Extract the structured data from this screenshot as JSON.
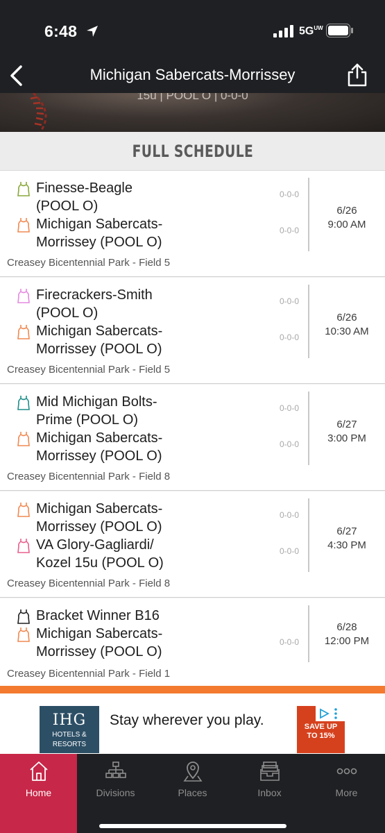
{
  "status_bar": {
    "time": "6:48",
    "network": "5G",
    "network_sup": "UW"
  },
  "nav": {
    "title": "Michigan Sabercats-Morrissey"
  },
  "banner": {
    "text": "15u | POOL O | 0-0-0"
  },
  "section": {
    "title": "FULL SCHEDULE"
  },
  "games": [
    {
      "team1": {
        "name_line1": "Finesse-Beagle",
        "name_line2": "(POOL O)",
        "score": "0-0-0",
        "color": "#8aa83c"
      },
      "team2": {
        "name_line1": "Michigan Sabercats-",
        "name_line2": "Morrissey (POOL O)",
        "score": "0-0-0",
        "color": "#f08a52"
      },
      "date": "6/26",
      "time": "9:00 AM",
      "venue": "Creasey Bicentennial Park - Field 5"
    },
    {
      "team1": {
        "name_line1": "Firecrackers-Smith",
        "name_line2": "(POOL O)",
        "score": "0-0-0",
        "color": "#e48ae0"
      },
      "team2": {
        "name_line1": "Michigan Sabercats-",
        "name_line2": "Morrissey (POOL O)",
        "score": "0-0-0",
        "color": "#f08a52"
      },
      "date": "6/26",
      "time": "10:30 AM",
      "venue": "Creasey Bicentennial Park - Field 5"
    },
    {
      "team1": {
        "name_line1": "Mid Michigan Bolts-",
        "name_line2": "Prime (POOL O)",
        "score": "0-0-0",
        "color": "#1f8f8a"
      },
      "team2": {
        "name_line1": "Michigan Sabercats-",
        "name_line2": "Morrissey (POOL O)",
        "score": "0-0-0",
        "color": "#f08a52"
      },
      "date": "6/27",
      "time": "3:00 PM",
      "venue": "Creasey Bicentennial Park - Field 8"
    },
    {
      "team1": {
        "name_line1": "Michigan Sabercats-",
        "name_line2": "Morrissey (POOL O)",
        "score": "0-0-0",
        "color": "#f08a52"
      },
      "team2": {
        "name_line1": "VA Glory-Gagliardi/",
        "name_line2": "Kozel 15u (POOL O)",
        "score": "0-0-0",
        "color": "#e8608e"
      },
      "date": "6/27",
      "time": "4:30 PM",
      "venue": "Creasey Bicentennial Park - Field 8"
    },
    {
      "team1": {
        "name_line1": "Bracket Winner B16",
        "name_line2": "",
        "score": "",
        "color": "#222222"
      },
      "team2": {
        "name_line1": "Michigan Sabercats-",
        "name_line2": "Morrissey (POOL O)",
        "score": "0-0-0",
        "color": "#f08a52"
      },
      "date": "6/28",
      "time": "12:00 PM",
      "venue": "Creasey Bicentennial Park - Field 1"
    }
  ],
  "ad": {
    "logo_main": "IHG",
    "logo_sub1": "HOTELS &",
    "logo_sub2": "RESORTS",
    "headline": "Stay wherever you play.",
    "badge_line1": "SAVE UP",
    "badge_line2": "TO 15%"
  },
  "tabs": [
    {
      "label": "Home",
      "icon": "home-icon",
      "active": true
    },
    {
      "label": "Divisions",
      "icon": "divisions-icon",
      "active": false
    },
    {
      "label": "Places",
      "icon": "places-icon",
      "active": false
    },
    {
      "label": "Inbox",
      "icon": "inbox-icon",
      "active": false
    },
    {
      "label": "More",
      "icon": "more-icon",
      "active": false
    }
  ],
  "colors": {
    "accent": "#c72748",
    "orange_bar": "#f37a2e",
    "background_dark": "#1f2023"
  }
}
